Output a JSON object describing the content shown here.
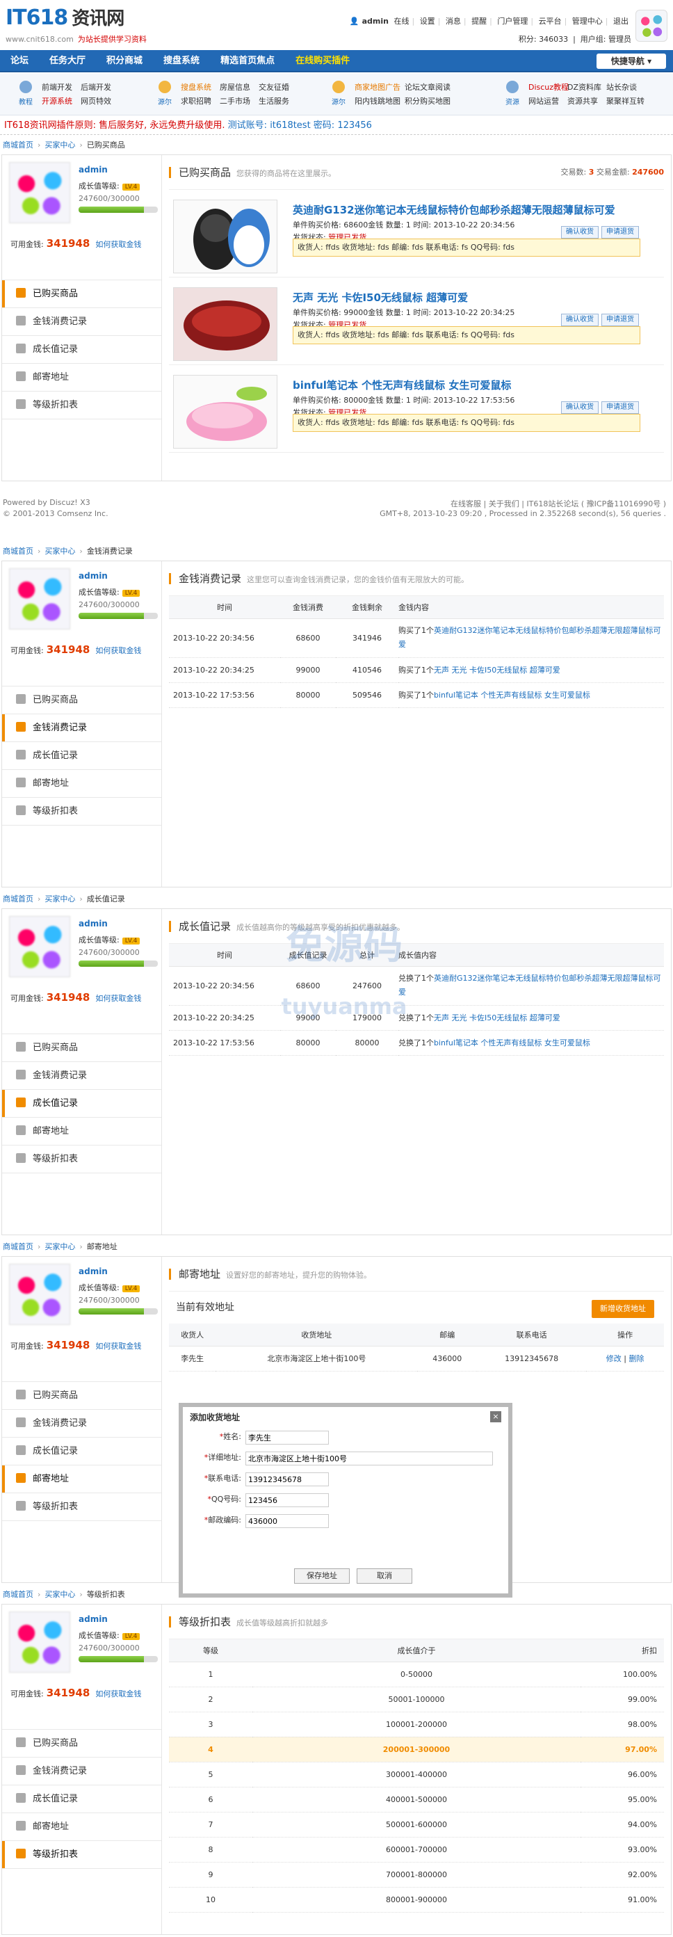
{
  "header": {
    "logo": "IT618",
    "logo_cn": "资讯网",
    "domain": "www.cnit618.com",
    "slogan": "为站长提供学习资料",
    "topbar": [
      "admin",
      "在线",
      "设置",
      "消息",
      "提醒",
      "门户管理",
      "云平台",
      "管理中心",
      "退出"
    ],
    "points": "积分: 346033",
    "usergroup": "用户组: 管理员"
  },
  "nav": {
    "items": [
      "论坛",
      "任务大厅",
      "积分商城",
      "搜盘系统",
      "精选首页焦点",
      "在线购买插件"
    ],
    "quick": "快捷导航"
  },
  "subnav": {
    "groups": [
      {
        "icon": "教程",
        "links": [
          "前端开发",
          "后端开发",
          "开源系统",
          "网页特效"
        ]
      },
      {
        "icon": "源尔",
        "links": [
          "搜盘系统",
          "房屋信息",
          "交友征婚",
          "求职招聘",
          "二手市场",
          "生活服务"
        ]
      },
      {
        "icon": "源尔",
        "links": [
          "商家地图广告",
          "论坛文章阅读",
          "阳内钱跳地图",
          "积分购买地图"
        ]
      },
      {
        "icon": "资源",
        "links": [
          "Discuz教程",
          "DZ资料库",
          "站长杂谈",
          "网站运营",
          "资源共享",
          "聚聚祥互转"
        ]
      }
    ]
  },
  "notice": {
    "a": "IT618资讯网插件原则:",
    "b": "售后服务好, 永远免费升级使用.",
    "c": "测试账号:",
    "d": "it618test 密码:",
    "e": "123456"
  },
  "crumbs": {
    "home": "商城首页",
    "center": "买家中心",
    "purchased": "已购买商品",
    "money": "金钱消费记录",
    "growth": "成长值记录",
    "address": "邮寄地址",
    "discount": "等级折扣表"
  },
  "profile": {
    "name": "admin",
    "level_label": "成长值等级:",
    "level": "LV.4",
    "exp": "247600/300000",
    "exp_fraction": 0.825,
    "money_label": "可用金钱:",
    "money": "341948",
    "money_link": "如何获取金钱"
  },
  "menu": [
    "已购买商品",
    "金钱消费记录",
    "成长值记录",
    "邮寄地址",
    "等级折扣表"
  ],
  "purchased": {
    "title": "已购买商品",
    "desc": "您获得的商品将在这里展示。",
    "stat_label": "交易数:",
    "stat_count": "3",
    "stat_money_label": "交易金额:",
    "stat_money": "247600",
    "goods": [
      {
        "title": "英迪耐G132迷你笔记本无线鼠标特价包邮秒杀超薄无限超薄鼠标可爱",
        "info": "单件购买价格: 68600金钱 数量: 1 时间: 2013-10-22 20:34:56",
        "status": "管理已发货",
        "box": "收货人: ffds 收货地址: fds 邮编: fds 联系电话: fs QQ号码: fds",
        "btn1": "确认收货",
        "btn2": "申请退货"
      },
      {
        "title": "无声 无光 卡佐I50无线鼠标 超薄可爱",
        "info": "单件购买价格: 99000金钱 数量: 1 时间: 2013-10-22 20:34:25",
        "status": "管理已发货",
        "box": "收货人: ffds 收货地址: fds 邮编: fds 联系电话: fs QQ号码: fds",
        "btn1": "确认收货",
        "btn2": "申请退货"
      },
      {
        "title": "binful笔记本 个性无声有线鼠标 女生可爱鼠标",
        "info": "单件购买价格: 80000金钱 数量: 1 时间: 2013-10-22 17:53:56",
        "status": "管理已发货",
        "box": "收货人: ffds 收货地址: fds 邮编: fds 联系电话: fs QQ号码: fds",
        "btn1": "确认收货",
        "btn2": "申请退货"
      }
    ]
  },
  "footer": {
    "powered": "Powered by Discuz! X3",
    "copy": "© 2001-2013 Comsenz Inc.",
    "links": "在线客服 | 关于我们 | IT618站长论坛 ( 豫ICP备11016990号 )",
    "time": "GMT+8, 2013-10-23 09:20 , Processed in 2.352268 second(s), 56 queries ."
  },
  "money": {
    "title": "金钱消费记录",
    "desc": "这里您可以查询金钱消费记录，您的金钱价值有无限放大的可能。",
    "headers": [
      "时间",
      "金钱消费",
      "金钱剩余",
      "金钱内容"
    ],
    "rows": [
      {
        "time": "2013-10-22 20:34:56",
        "cost": "68600",
        "left": "341946",
        "pre": "购买了1个",
        "item": "英迪耐G132迷你笔记本无线鼠标特价包邮秒杀超薄无限超薄鼠标可爱"
      },
      {
        "time": "2013-10-22 20:34:25",
        "cost": "99000",
        "left": "410546",
        "pre": "购买了1个",
        "item": "无声 无光 卡佐I50无线鼠标 超薄可爱"
      },
      {
        "time": "2013-10-22 17:53:56",
        "cost": "80000",
        "left": "509546",
        "pre": "购买了1个",
        "item": "binful笔记本 个性无声有线鼠标 女生可爱鼠标"
      }
    ]
  },
  "growth": {
    "title": "成长值记录",
    "desc": "成长值越高你的等级越高享受的折扣优惠就越多。",
    "headers": [
      "时间",
      "成长值记录",
      "总计",
      "成长值内容"
    ],
    "rows": [
      {
        "time": "2013-10-22 20:34:56",
        "add": "68600",
        "total": "247600",
        "pre": "兑换了1个",
        "item": "英迪耐G132迷你笔记本无线鼠标特价包邮秒杀超薄无限超薄鼠标可爱"
      },
      {
        "time": "2013-10-22 20:34:25",
        "add": "99000",
        "total": "179000",
        "pre": "兑换了1个",
        "item": "无声 无光 卡佐I50无线鼠标 超薄可爱"
      },
      {
        "time": "2013-10-22 17:53:56",
        "add": "80000",
        "total": "80000",
        "pre": "兑换了1个",
        "item": "binful笔记本 个性无声有线鼠标 女生可爱鼠标"
      }
    ]
  },
  "address": {
    "title": "邮寄地址",
    "desc": "设置好您的邮寄地址，提升您的购物体验。",
    "current": "当前有效地址",
    "add_btn": "新增收货地址",
    "headers": [
      "收货人",
      "收货地址",
      "邮编",
      "联系电话",
      "操作"
    ],
    "row": {
      "name": "李先生",
      "addr": "北京市海淀区上地十街100号",
      "zip": "436000",
      "phone": "13912345678",
      "edit": "修改",
      "del": "删除"
    },
    "dialog": {
      "title": "添加收货地址",
      "close": "×",
      "fields": [
        {
          "label": "姓名:",
          "value": "李先生"
        },
        {
          "label": "详细地址:",
          "value": "北京市海淀区上地十街100号"
        },
        {
          "label": "联系电话:",
          "value": "13912345678"
        },
        {
          "label": "QQ号码:",
          "value": "123456"
        },
        {
          "label": "邮政编码:",
          "value": "436000"
        }
      ],
      "save": "保存地址",
      "cancel": "取消"
    }
  },
  "discount": {
    "title": "等级折扣表",
    "desc": "成长值等级越高折扣就越多",
    "headers": [
      "等级",
      "成长值介于",
      "折扣"
    ],
    "rows": [
      [
        "1",
        "0-50000",
        "100.00%"
      ],
      [
        "2",
        "50001-100000",
        "99.00%"
      ],
      [
        "3",
        "100001-200000",
        "98.00%"
      ],
      [
        "4",
        "200001-300000",
        "97.00%"
      ],
      [
        "5",
        "300001-400000",
        "96.00%"
      ],
      [
        "6",
        "400001-500000",
        "95.00%"
      ],
      [
        "7",
        "500001-600000",
        "94.00%"
      ],
      [
        "8",
        "600001-700000",
        "93.00%"
      ],
      [
        "9",
        "700001-800000",
        "92.00%"
      ],
      [
        "10",
        "800001-900000",
        "91.00%"
      ]
    ],
    "highlight_index": 3
  },
  "watermark": {
    "cn": "免源码",
    "en": "tuyuanma"
  }
}
